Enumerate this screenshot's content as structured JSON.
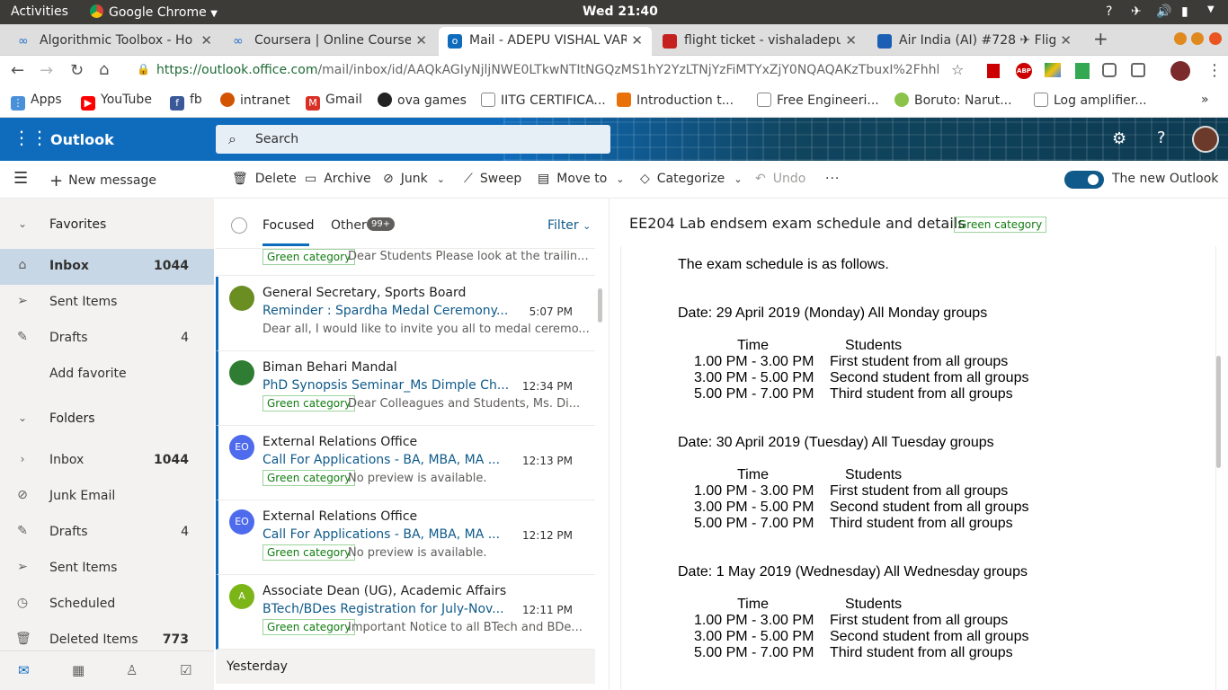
{
  "system": {
    "activities": "Activities",
    "app": "Google Chrome",
    "clock": "Wed 21:40"
  },
  "tabs": [
    {
      "title": "Algorithmic Toolbox - Ho",
      "color": "#2a73cc"
    },
    {
      "title": "Coursera | Online Courses",
      "color": "#2a73cc"
    },
    {
      "title": "Mail - ADEPU VISHAL VAR",
      "color": "#0f6cbd"
    },
    {
      "title": "flight ticket - vishaladepu",
      "color": "#c5221f"
    },
    {
      "title": "Air India (AI) #728 ✈ Fligh",
      "color": "#1a5fb4"
    }
  ],
  "address": {
    "url_host": "https://outlook.office.com",
    "url_path": "/mail/inbox/id/AAQkAGIyNjljNWE0LTkwNTItNGQzMS1hY2YzLTNjYzFiMTYxZjY0NQAQAKzTbuxI%2Fhhlh2S4z..."
  },
  "bookmarks": [
    {
      "label": "Apps",
      "color": "#4a90d9"
    },
    {
      "label": "YouTube",
      "color": "#ff0000"
    },
    {
      "label": "fb",
      "color": "#3b5998"
    },
    {
      "label": "intranet",
      "color": "#d35400"
    },
    {
      "label": "Gmail",
      "color": "#d93025"
    },
    {
      "label": "ova games",
      "color": "#222222"
    },
    {
      "label": "IITG CERTIFICA...",
      "color": "#888888"
    },
    {
      "label": "Introduction t...",
      "color": "#e8710a"
    },
    {
      "label": "Free Engineeri...",
      "color": "#888888"
    },
    {
      "label": "Boruto: Narut...",
      "color": "#8bc34a"
    },
    {
      "label": "Log amplifier...",
      "color": "#888888"
    }
  ],
  "suite": {
    "app_name": "Outlook",
    "search_placeholder": "Search"
  },
  "commands": {
    "new_message": "New message",
    "delete": "Delete",
    "archive": "Archive",
    "junk": "Junk",
    "sweep": "Sweep",
    "move_to": "Move to",
    "categorize": "Categorize",
    "undo": "Undo",
    "new_outlook": "The new Outlook"
  },
  "nav": {
    "favorites": "Favorites",
    "fav_items": [
      {
        "label": "Inbox",
        "count": "1044"
      },
      {
        "label": "Sent Items",
        "count": ""
      },
      {
        "label": "Drafts",
        "count": "4"
      },
      {
        "label": "Add favorite",
        "count": ""
      }
    ],
    "folders": "Folders",
    "folder_items": [
      {
        "label": "Inbox",
        "count": "1044"
      },
      {
        "label": "Junk Email",
        "count": ""
      },
      {
        "label": "Drafts",
        "count": "4"
      },
      {
        "label": "Sent Items",
        "count": ""
      },
      {
        "label": "Scheduled",
        "count": ""
      },
      {
        "label": "Deleted Items",
        "count": "773"
      }
    ]
  },
  "list": {
    "focused": "Focused",
    "other": "Other",
    "other_badge": "99+",
    "filter": "Filter",
    "partial_category": "Green category",
    "partial_preview": "Dear Students Please look at the trailin...",
    "items": [
      {
        "sender": "General Secretary, Sports Board",
        "subject": "Reminder : Spardha Medal Ceremony...",
        "time": "5:07 PM",
        "category": "",
        "preview": "Dear all, I would like to invite you all to medal ceremo...",
        "avatar": "",
        "avatar_color": "#6b8e23"
      },
      {
        "sender": "Biman Behari Mandal",
        "subject": "PhD Synopsis Seminar_Ms Dimple Ch...",
        "time": "12:34 PM",
        "category": "Green category",
        "preview": "Dear Colleagues and Students, Ms. Di...",
        "avatar": "",
        "avatar_color": "#2e7d32"
      },
      {
        "sender": "External Relations Office",
        "subject": "Call For Applications - BA, MBA, MA ...",
        "time": "12:13 PM",
        "category": "Green category",
        "preview": "No preview is available.",
        "avatar": "EO",
        "avatar_color": "#4f6bed"
      },
      {
        "sender": "External Relations Office",
        "subject": "Call For Applications - BA, MBA, MA ...",
        "time": "12:12 PM",
        "category": "Green category",
        "preview": "No preview is available.",
        "avatar": "EO",
        "avatar_color": "#4f6bed"
      },
      {
        "sender": "Associate Dean (UG), Academic Affairs",
        "subject": "BTech/BDes Registration for July-Nov...",
        "time": "12:11 PM",
        "category": "Green category",
        "preview": "Important Notice to all BTech and BDe...",
        "avatar": "A",
        "avatar_color": "#7cb518"
      }
    ],
    "yesterday": "Yesterday"
  },
  "reading": {
    "title": "EE204 Lab endsem exam schedule and details",
    "category": "Green category",
    "intro": "The exam schedule is as follows.",
    "days": [
      {
        "date": "Date: 29 April 2019 (Monday) All Monday groups",
        "time_h": "Time",
        "stud_h": "Students",
        "rows": [
          [
            "1.00 PM - 3.00 PM",
            "First student from all groups"
          ],
          [
            "3.00 PM - 5.00 PM",
            "Second student from all groups"
          ],
          [
            "5.00 PM - 7.00 PM",
            "Third student from all groups"
          ]
        ]
      },
      {
        "date": "Date: 30 April 2019 (Tuesday) All Tuesday groups",
        "time_h": "Time",
        "stud_h": "Students",
        "rows": [
          [
            "1.00 PM - 3.00 PM",
            "First student from all groups"
          ],
          [
            "3.00 PM - 5.00 PM",
            "Second student from all groups"
          ],
          [
            "5.00 PM - 7.00 PM",
            "Third student from all groups"
          ]
        ]
      },
      {
        "date": "Date: 1 May 2019 (Wednesday) All Wednesday groups",
        "time_h": "Time",
        "stud_h": "Students",
        "rows": [
          [
            "1.00 PM - 3.00 PM",
            "First student from all groups"
          ],
          [
            "3.00 PM - 5.00 PM",
            "Second student from all groups"
          ],
          [
            "5.00 PM - 7.00 PM",
            "Third student from all groups"
          ]
        ]
      }
    ]
  }
}
